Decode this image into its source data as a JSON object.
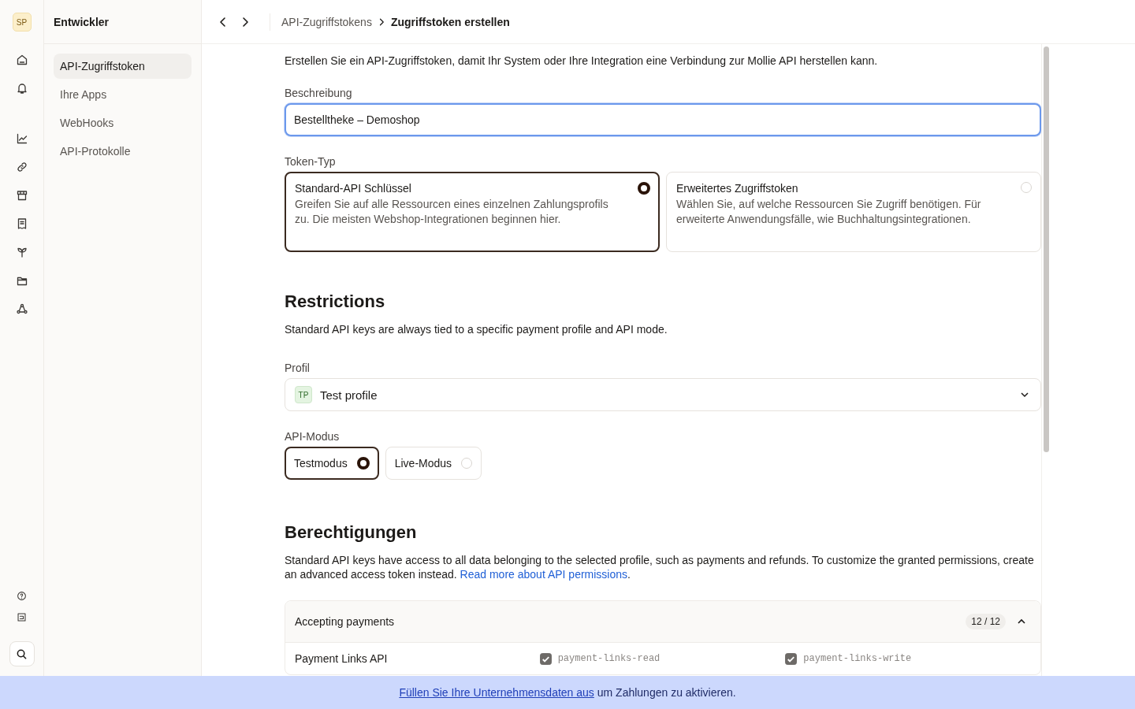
{
  "rail": {
    "avatar": "SP"
  },
  "sidebar": {
    "title": "Entwickler",
    "items": [
      {
        "label": "API-Zugriffstoken",
        "selected": true
      },
      {
        "label": "Ihre Apps",
        "selected": false
      },
      {
        "label": "WebHooks",
        "selected": false
      },
      {
        "label": "API-Protokolle",
        "selected": false
      }
    ]
  },
  "breadcrumb": [
    "API-Zugriffstokens",
    "Zugriffstoken erstellen"
  ],
  "intro": "Erstellen Sie ein API-Zugriffstoken, damit Ihr System oder Ihre Integration eine Verbindung zur Mollie API herstellen kann.",
  "description": {
    "label": "Beschreibung",
    "value": "Bestelltheke – Demoshop",
    "focused": true
  },
  "token_type": {
    "label": "Token-Typ",
    "options": [
      {
        "title": "Standard-API Schlüssel",
        "text": "Greifen Sie auf alle Ressourcen eines einzelnen Zahlungsprofils zu. Die meisten Webshop-Integrationen beginnen hier.",
        "selected": true
      },
      {
        "title": "Erweitertes Zugriffstoken",
        "text": "Wählen Sie, auf welche Ressourcen Sie Zugriff benötigen. Für erweiterte Anwendungsfälle, wie Buchhaltungsintegrationen.",
        "selected": false
      }
    ]
  },
  "restrictions": {
    "heading": "Restrictions",
    "text": "Standard API keys are always tied to a specific payment profile and API mode.",
    "profile": {
      "label": "Profil",
      "badge": "TP",
      "value": "Test profile"
    },
    "mode": {
      "label": "API-Modus",
      "options": [
        {
          "label": "Testmodus",
          "selected": true
        },
        {
          "label": "Live-Modus",
          "selected": false
        }
      ]
    }
  },
  "permissions": {
    "heading": "Berechtigungen",
    "text": "Standard API keys have access to all data belonging to the selected profile, such as payments and refunds. To customize the granted permissions, create an advanced access token instead. ",
    "link": "Read more about API permissions",
    "text_end": ".",
    "groups": [
      {
        "title": "Accepting payments",
        "count": "12 / 12",
        "expanded": true,
        "rows": [
          {
            "name": "Payment Links API",
            "scopes": [
              {
                "label": "payment-links-read",
                "checked": true
              },
              {
                "label": "payment-links-write",
                "checked": true
              }
            ]
          }
        ]
      }
    ]
  },
  "banner": {
    "link": "Füllen Sie Ihre Unternehmensdaten aus",
    "text": " um Zahlungen zu aktivieren."
  }
}
